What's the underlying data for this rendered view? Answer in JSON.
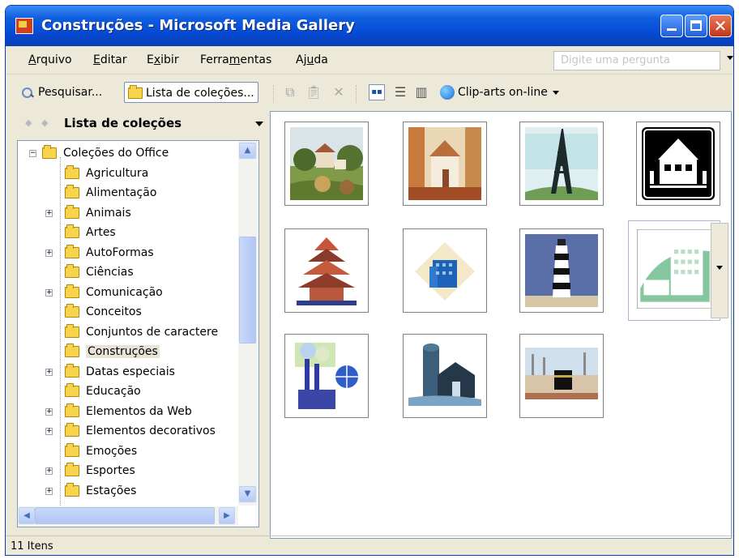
{
  "window": {
    "title": "Construções - Microsoft Media Gallery"
  },
  "menu": [
    {
      "mnemonic": "A",
      "rest": "rquivo"
    },
    {
      "mnemonic": "E",
      "rest": "ditar"
    },
    {
      "pre": "E",
      "mnemonic": "x",
      "rest": "ibir"
    },
    {
      "pre": "Ferra",
      "mnemonic": "m",
      "rest": "entas"
    },
    {
      "pre": "Aj",
      "mnemonic": "u",
      "rest": "da"
    }
  ],
  "help_placeholder": "Digite uma pergunta",
  "toolbar": {
    "search_label": "Pesquisar...",
    "collections_label": "Lista de coleções...",
    "online_label": "Clip-arts on-line"
  },
  "task_pane": {
    "title": "Lista de coleções"
  },
  "tree": {
    "root": "Coleções do Office",
    "items": [
      {
        "label": "Agricultura",
        "expandable": false
      },
      {
        "label": "Alimentação",
        "expandable": false
      },
      {
        "label": "Animais",
        "expandable": true
      },
      {
        "label": "Artes",
        "expandable": false
      },
      {
        "label": "AutoFormas",
        "expandable": true
      },
      {
        "label": "Ciências",
        "expandable": false
      },
      {
        "label": "Comunicação",
        "expandable": true
      },
      {
        "label": "Conceitos",
        "expandable": false
      },
      {
        "label": "Conjuntos de caractere",
        "expandable": false
      },
      {
        "label": "Construções",
        "expandable": false,
        "selected": true
      },
      {
        "label": "Datas especiais",
        "expandable": true
      },
      {
        "label": "Educação",
        "expandable": false
      },
      {
        "label": "Elementos da Web",
        "expandable": true
      },
      {
        "label": "Elementos decorativos",
        "expandable": true
      },
      {
        "label": "Emoções",
        "expandable": false
      },
      {
        "label": "Esportes",
        "expandable": true
      },
      {
        "label": "Estações",
        "expandable": true
      }
    ]
  },
  "gallery": [
    "village-landscape",
    "church-painting",
    "eiffel-tower",
    "house-sign",
    "pagoda",
    "office-building",
    "lighthouse",
    "green-building",
    "factory-globe",
    "silo-barn",
    "kaaba"
  ],
  "status": "11 Itens"
}
